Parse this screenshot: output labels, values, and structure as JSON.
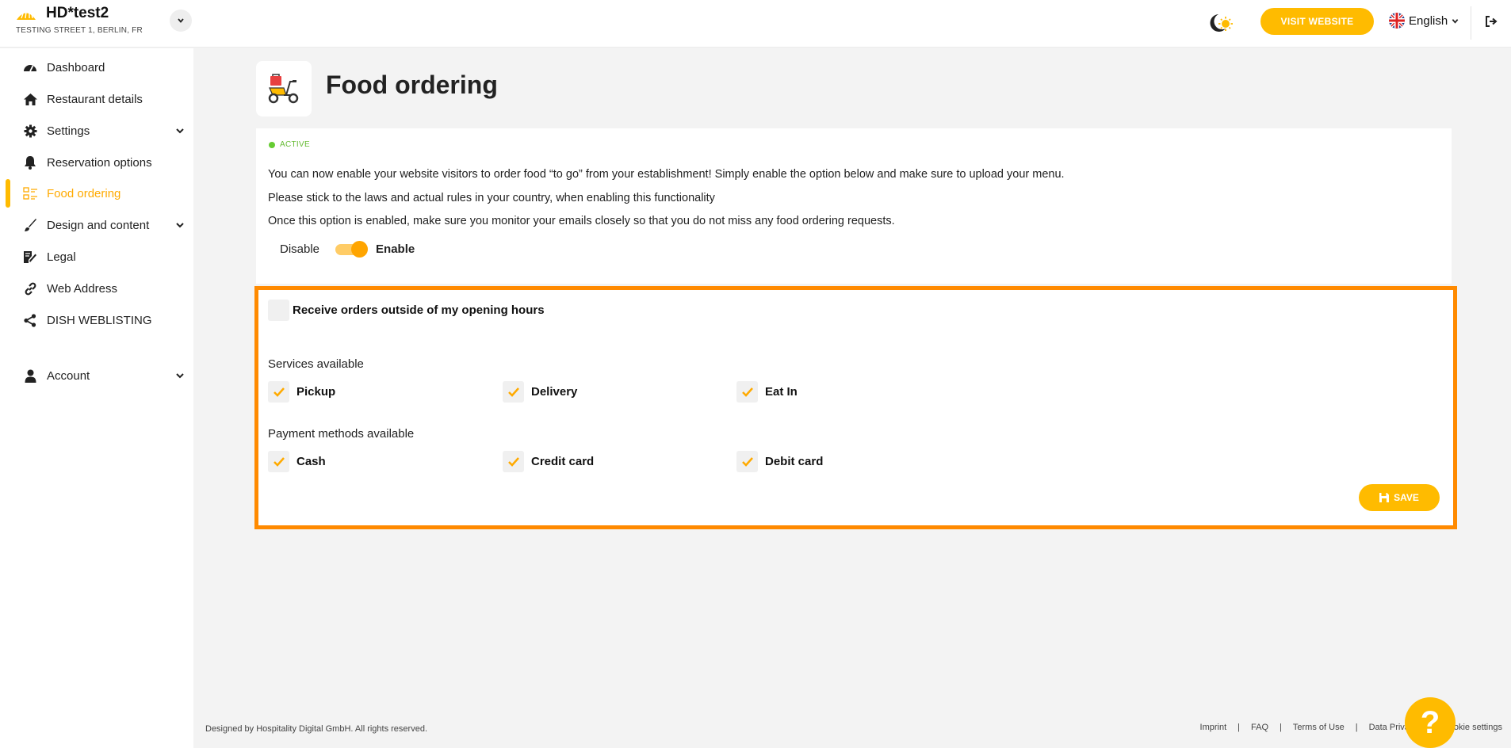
{
  "header": {
    "brand_name": "HD*test2",
    "brand_address": "TESTING STREET 1, BERLIN, FR",
    "visit_website": "VISIT WEBSITE",
    "language": "English"
  },
  "sidebar": {
    "items": [
      {
        "label": "Dashboard",
        "icon": "speedometer-icon"
      },
      {
        "label": "Restaurant details",
        "icon": "home-icon"
      },
      {
        "label": "Settings",
        "icon": "gear-icon"
      },
      {
        "label": "Reservation options",
        "icon": "bell-icon"
      },
      {
        "label": "Food ordering",
        "icon": "food-ordering-icon"
      },
      {
        "label": "Design and content",
        "icon": "brush-icon"
      },
      {
        "label": "Legal",
        "icon": "document-sign-icon"
      },
      {
        "label": "Web Address",
        "icon": "link-icon"
      },
      {
        "label": "DISH WEBLISTING",
        "icon": "share-icon"
      },
      {
        "label": "Account",
        "icon": "user-icon"
      }
    ],
    "active": "Food ordering"
  },
  "main": {
    "title": "Food ordering",
    "status": "ACTIVE",
    "paragraphs": [
      "You can now enable your website visitors to order food “to go” from your establishment! Simply enable the option below and make sure to upload your menu.",
      "Please stick to the laws and actual rules in your country, when enabling this functionality",
      "Once this option is enabled, make sure you monitor your emails closely so that you do not miss any food ordering requests."
    ],
    "toggle": {
      "off_label": "Disable",
      "on_label": "Enable",
      "enabled": true
    },
    "outside_hours": {
      "label": "Receive orders outside of my opening hours",
      "checked": false
    },
    "services": {
      "label": "Services available",
      "options": [
        {
          "label": "Pickup",
          "checked": true
        },
        {
          "label": "Delivery",
          "checked": true
        },
        {
          "label": "Eat In",
          "checked": true
        }
      ]
    },
    "payments": {
      "label": "Payment methods available",
      "options": [
        {
          "label": "Cash",
          "checked": true
        },
        {
          "label": "Credit card",
          "checked": true
        },
        {
          "label": "Debit card",
          "checked": true
        }
      ]
    },
    "save": "SAVE"
  },
  "footer": {
    "copyright": "Designed by Hospitality Digital GmbH. All rights reserved.",
    "links": [
      "Imprint",
      "FAQ",
      "Terms of Use",
      "Data Privacy",
      "Cookie settings"
    ]
  },
  "colors": {
    "accent": "#ffbb00",
    "highlight_border": "#ff8a00",
    "active_status": "#66cc33"
  }
}
